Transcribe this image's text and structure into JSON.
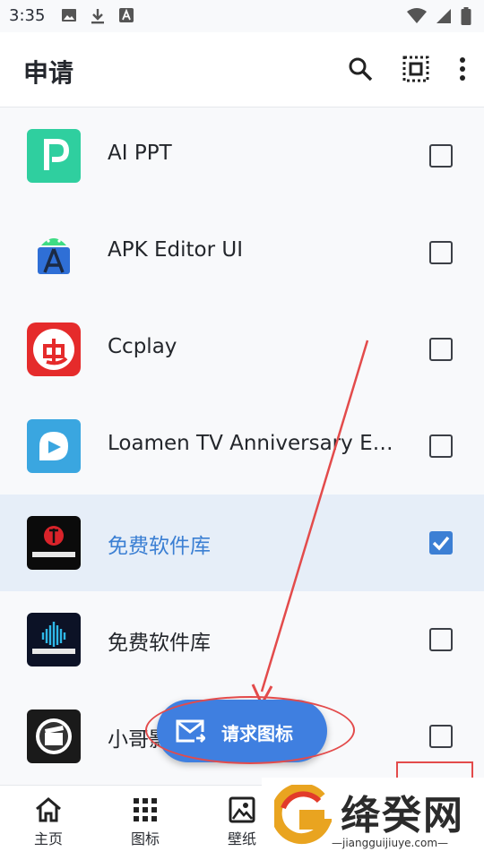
{
  "status_bar": {
    "time": "3:35",
    "left_icons": [
      "image-icon",
      "download-icon",
      "font-icon"
    ],
    "right_icons": [
      "wifi-icon",
      "signal-icon",
      "battery-icon"
    ]
  },
  "app_bar": {
    "title": "申请",
    "actions": [
      "search-icon",
      "select-all-icon",
      "more-vert-icon"
    ]
  },
  "apps": [
    {
      "name": "AI PPT",
      "checked": false,
      "icon": "ai-ppt-icon",
      "selected": false
    },
    {
      "name": "APK Editor UI",
      "checked": false,
      "icon": "apk-editor-icon",
      "selected": false
    },
    {
      "name": "Ccplay",
      "checked": false,
      "icon": "ccplay-icon",
      "selected": false
    },
    {
      "name": "Loamen TV Anniversary Edition",
      "checked": false,
      "icon": "loamen-tv-icon",
      "selected": false
    },
    {
      "name": "免费软件库",
      "checked": true,
      "icon": "free-software-library-icon",
      "selected": true
    },
    {
      "name": "免费软件库",
      "checked": false,
      "icon": "free-software-library-2-icon",
      "selected": false
    },
    {
      "name": "小哥影视",
      "checked": false,
      "icon": "movie-clapper-icon",
      "selected": false
    }
  ],
  "fab": {
    "label": "请求图标",
    "icon": "mail-send-icon"
  },
  "bottom_nav": [
    {
      "label": "主页",
      "icon": "home-icon"
    },
    {
      "label": "图标",
      "icon": "grid-icon"
    },
    {
      "label": "壁纸",
      "icon": "image-icon"
    }
  ],
  "watermark": {
    "title": "绛癸网",
    "url": "—jiangguijiuye.com—"
  },
  "colors": {
    "accent": "#3f7fe0",
    "selected_row": "#e6eef8",
    "annotation": "#e34b4b"
  }
}
